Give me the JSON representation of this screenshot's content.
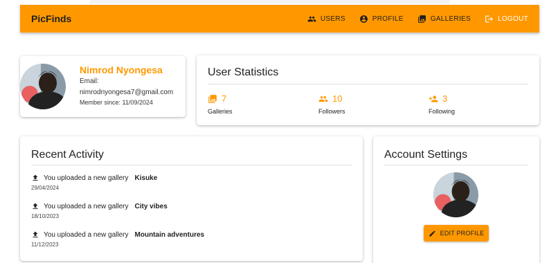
{
  "appbar": {
    "brand": "PicFinds",
    "nav": [
      {
        "label": "USERS",
        "icon": "users-icon"
      },
      {
        "label": "PROFILE",
        "icon": "account-circle-icon"
      },
      {
        "label": "GALLERIES",
        "icon": "galleries-icon"
      },
      {
        "label": "LOGOUT",
        "icon": "logout-icon"
      }
    ]
  },
  "profile": {
    "name": "Nimrod Nyongesa",
    "email_label": "Email:",
    "email": "nimrodnyongesa7@gmail.com",
    "member_since": "Member since: 11/09/2024"
  },
  "stats": {
    "title": "User Statistics",
    "items": [
      {
        "value": "7",
        "label": "Galleries",
        "icon": "photo-library-icon"
      },
      {
        "value": "10",
        "label": "Followers",
        "icon": "people-icon"
      },
      {
        "value": "3",
        "label": "Following",
        "icon": "person-add-icon"
      }
    ]
  },
  "activity": {
    "title": "Recent Activity",
    "items": [
      {
        "text": "You uploaded a new gallery",
        "gallery": "Kisuke",
        "date": "29/04/2024"
      },
      {
        "text": "You uploaded a new gallery",
        "gallery": "City vibes",
        "date": "18/10/2023"
      },
      {
        "text": "You uploaded a new gallery",
        "gallery": "Mountain adventures",
        "date": "11/12/2023"
      }
    ]
  },
  "settings": {
    "title": "Account Settings",
    "edit_label": "EDIT PROFILE"
  },
  "colors": {
    "accent": "#ff9800",
    "logout_text": "#ffffff"
  }
}
